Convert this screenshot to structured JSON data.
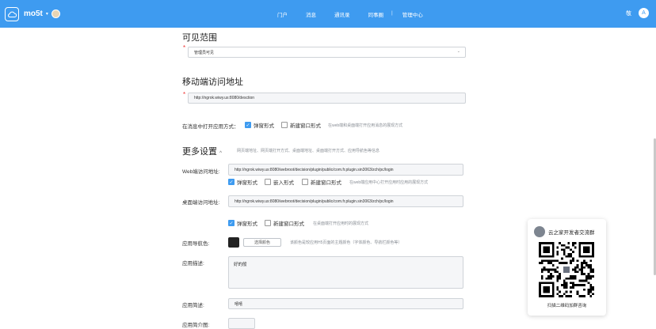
{
  "topbar": {
    "brand": "mo5t",
    "caret": "▾",
    "nav": [
      "门户",
      "消息",
      "通讯录",
      "同事圈",
      "管理中心"
    ],
    "separator": "|",
    "user_name": "敬",
    "avatar_glyph": "A"
  },
  "visibility": {
    "title": "可见范围",
    "value": "管理员可见",
    "dropdown_icon": "chevron-down-icon"
  },
  "mobile": {
    "title": "移动端访问地址",
    "value": "http://ngrok.wiwy.us:8080/desction"
  },
  "open_in_msg": {
    "label": "在消息中打开应用方式：",
    "opt1": "弹窗形式",
    "opt2": "新建窗口形式",
    "hint": "在web端和桌面端打开应用消息的展现方式"
  },
  "more": {
    "title": "更多设置",
    "toggle": "^",
    "hint": "网页端地址、网页端打开方式、桌面端地址、桌面端打开方式、应用导航色等信息"
  },
  "web_url": {
    "label": "Web端访问地址:",
    "value": "http://ngrok.wiwy.us:8080/webroot/decision/plugin/public/com.fr.plugin.sin3063/zch/pc/login",
    "opt1": "弹窗形式",
    "opt2": "嵌入形式",
    "opt3": "新建窗口形式",
    "hint": "在web端应用中心打开应用时应用的展现方式"
  },
  "desktop_url": {
    "label": "桌面端访问地址:",
    "value": "http://ngrok.wiwy.us:8080/webroot/decision/plugin/public/com.fr.plugin.sin3063/zch/pc/login",
    "opt1": "弹窗形式",
    "opt2": "新建窗口形式",
    "hint": "在桌面端打开应用时的展现方式"
  },
  "nav_color": {
    "label": "应用导航色:",
    "color": "#222222",
    "button": "选择颜色",
    "hint": "该颜色是较应用H5页面的主题颜色（字体颜色、导航栏颜色等）"
  },
  "desc": {
    "label": "应用描述:",
    "value": "好的般"
  },
  "short_desc": {
    "label": "应用简述:",
    "value": "嘻嘻"
  },
  "intro_img": {
    "label": "应用简介图:"
  },
  "qr_card": {
    "title": "云之家开发者交流群",
    "footer": "扫描二维码加群咨询"
  }
}
